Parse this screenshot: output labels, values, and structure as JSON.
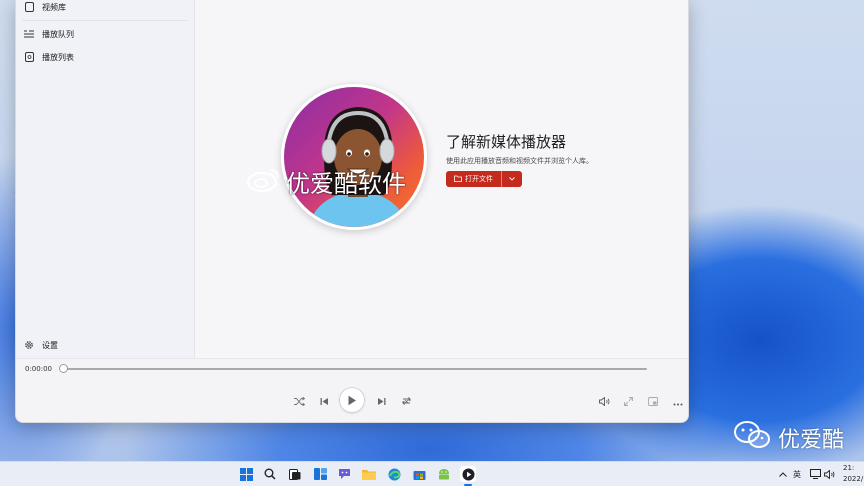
{
  "sidebar": {
    "items": [
      {
        "label": "视频库",
        "icon": "video-library-icon"
      },
      {
        "label": "播放队列",
        "icon": "queue-icon"
      },
      {
        "label": "播放列表",
        "icon": "playlist-icon"
      }
    ],
    "settings_label": "设置"
  },
  "main": {
    "headline": "了解新媒体播放器",
    "description": "使用此应用播放音频和视频文件并浏览个人库。",
    "open_file_label": "打开文件",
    "accent_color": "#c42b1c"
  },
  "player": {
    "current_time": "0:00:00",
    "progress": 0
  },
  "watermark": {
    "center_text": "优爱酷软件",
    "corner_text": "优爱酷"
  },
  "taskbar": {
    "icons": [
      "windows-start-icon",
      "search-icon",
      "task-view-icon",
      "widgets-icon",
      "chat-icon",
      "file-explorer-icon",
      "edge-icon",
      "store-icon",
      "android-icon",
      "media-player-icon"
    ],
    "ime_label": "英",
    "clock_time": "21:",
    "clock_date": "2022/"
  }
}
